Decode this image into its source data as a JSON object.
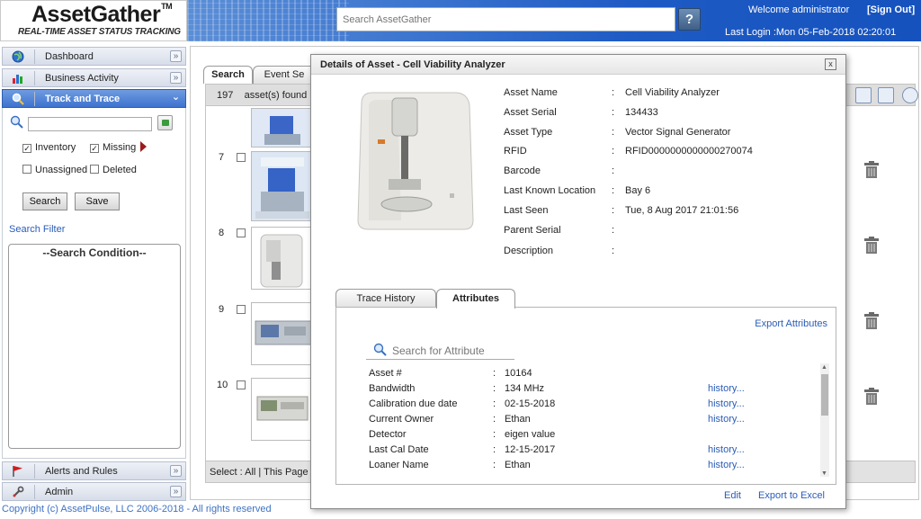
{
  "header": {
    "logo_title": "AssetGather",
    "logo_tm": "TM",
    "logo_subtitle": "REAL-TIME ASSET STATUS TRACKING",
    "search_placeholder": "Search AssetGather",
    "help_label": "?",
    "welcome": "Welcome  administrator",
    "sign_out": "[Sign Out]",
    "last_login": "Last Login :Mon 05-Feb-2018 02:20:01"
  },
  "sidebar": {
    "items": [
      {
        "label": "Dashboard",
        "icon": "globe-icon"
      },
      {
        "label": "Business Activity",
        "icon": "bar-chart-icon"
      },
      {
        "label": "Track and Trace",
        "icon": "magnifier-icon",
        "active": true
      },
      {
        "label": "Alerts and Rules",
        "icon": "flag-icon"
      },
      {
        "label": "Admin",
        "icon": "wrench-icon"
      }
    ],
    "filters": {
      "inventory": {
        "label": "Inventory",
        "checked": true
      },
      "missing": {
        "label": "Missing",
        "checked": true
      },
      "unassigned": {
        "label": "Unassigned",
        "checked": false
      },
      "deleted": {
        "label": "Deleted",
        "checked": false
      }
    },
    "search_button": "Search",
    "save_button": "Save",
    "search_filter_link": "Search Filter",
    "search_condition_title": "--Search Condition--"
  },
  "main": {
    "tabs": [
      "Search",
      "Event Se"
    ],
    "count": "197",
    "found_text": "asset(s) found",
    "rows": [
      {
        "num": ""
      },
      {
        "num": "7"
      },
      {
        "num": "8"
      },
      {
        "num": "9"
      },
      {
        "num": "10"
      }
    ],
    "bottom_text": "Select :  All  |  This Page"
  },
  "modal": {
    "title": "Details of Asset - Cell Viability Analyzer",
    "close_label": "x",
    "details": [
      {
        "label": "Asset Name",
        "value": "Cell Viability Analyzer"
      },
      {
        "label": "Asset Serial",
        "value": "134433"
      },
      {
        "label": "Asset Type",
        "value": "Vector Signal Generator"
      },
      {
        "label": "RFID",
        "value": "RFID0000000000000270074"
      },
      {
        "label": "Barcode",
        "value": ""
      },
      {
        "label": "Last Known Location",
        "value": "Bay 6"
      },
      {
        "label": "Last Seen",
        "value": "Tue, 8 Aug 2017 21:01:56"
      },
      {
        "label": "Parent Serial",
        "value": ""
      },
      {
        "label": "Description",
        "value": ""
      }
    ],
    "separator": ":",
    "tabs": [
      {
        "label": "Trace History",
        "active": false
      },
      {
        "label": "Attributes",
        "active": true
      }
    ],
    "export_attributes": "Export Attributes",
    "attr_search_placeholder": "Search for Attribute",
    "attributes": [
      {
        "label": "Asset #",
        "value": "10164",
        "history": ""
      },
      {
        "label": "Bandwidth",
        "value": "134 MHz",
        "history": "history..."
      },
      {
        "label": "Calibration due date",
        "value": "02-15-2018",
        "history": "history..."
      },
      {
        "label": "Current Owner",
        "value": "Ethan",
        "history": "history..."
      },
      {
        "label": "Detector",
        "value": "eigen value",
        "history": ""
      },
      {
        "label": "Last Cal Date",
        "value": "12-15-2017",
        "history": "history..."
      },
      {
        "label": "Loaner Name",
        "value": "Ethan",
        "history": "history..."
      }
    ],
    "edit_link": "Edit",
    "export_excel_link": "Export to Excel"
  },
  "footer": {
    "copyright": "Copyright (c) AssetPulse, LLC 2006-2018 - All rights reserved"
  },
  "colors": {
    "banner": "#1f5bc4",
    "nav_active": "#3d73cf",
    "link": "#2a5cb8"
  }
}
